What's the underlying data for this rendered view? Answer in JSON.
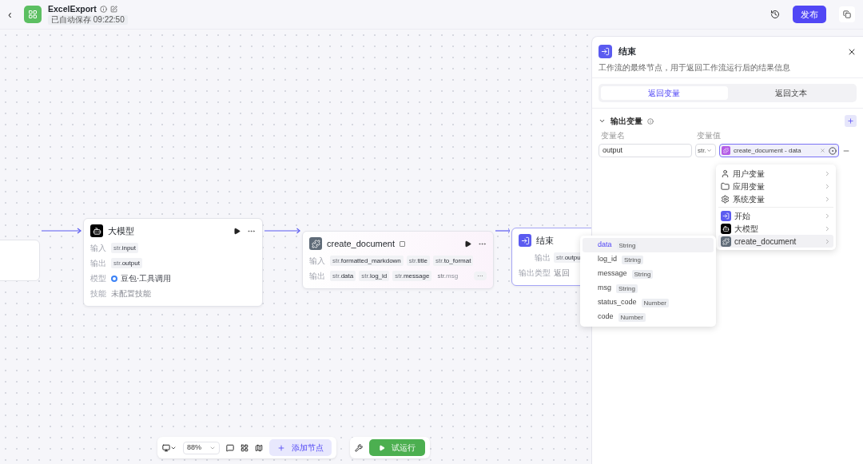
{
  "header": {
    "back": "‹",
    "title": "ExcelExport",
    "autosave": "已自动保存 09:22:50",
    "publish": "发布"
  },
  "nodes": [
    {
      "kind": "partial"
    },
    {
      "kind": "llm",
      "title": "大模型",
      "rows": [
        {
          "kind": "chips",
          "label": "输入",
          "chips": [
            {
              "prefix": "str.",
              "text": "input",
              "faded": false
            }
          ]
        },
        {
          "kind": "chips",
          "label": "输出",
          "chips": [
            {
              "prefix": "str.",
              "text": "output",
              "faded": false
            }
          ]
        },
        {
          "kind": "model",
          "label": "模型",
          "text": "豆包·工具调用"
        },
        {
          "kind": "empty",
          "label": "技能",
          "text": "未配置技能"
        }
      ]
    },
    {
      "kind": "plugin",
      "title": "create_document",
      "rows": [
        {
          "kind": "chips",
          "label": "输入",
          "chips": [
            {
              "prefix": "str.",
              "text": "formatted_markdown",
              "faded": false
            },
            {
              "prefix": "str.",
              "text": "title",
              "faded": false
            },
            {
              "prefix": "str.",
              "text": "to_format",
              "faded": false
            }
          ]
        },
        {
          "kind": "chips",
          "label": "输出",
          "more": "···",
          "chips": [
            {
              "prefix": "str.",
              "text": "data",
              "faded": false
            },
            {
              "prefix": "str.",
              "text": "log_id",
              "faded": false
            },
            {
              "prefix": "str.",
              "text": "message",
              "faded": false
            },
            {
              "prefix": "str.",
              "text": "msg",
              "faded": true
            }
          ]
        }
      ]
    },
    {
      "kind": "end",
      "title": "结束",
      "rows": [
        {
          "kind": "chips",
          "label": "输出",
          "chips": [
            {
              "prefix": "str.",
              "text": "outpu",
              "faded": false
            }
          ]
        },
        {
          "kind": "empty",
          "label": "输出类型",
          "text": "返回"
        }
      ]
    }
  ],
  "panel": {
    "title": "结束",
    "description": "工作流的最终节点，用于返回工作流运行后的结果信息",
    "tabs": [
      {
        "label": "返回变量",
        "selected": true
      },
      {
        "label": "返回文本",
        "selected": false
      }
    ],
    "section": {
      "title": "输出变量",
      "expanded": true,
      "col_name": "变量名",
      "col_value": "变量值",
      "row": {
        "name": "output",
        "type": "str.",
        "ref": "create_document - data"
      }
    }
  },
  "menu": [
    {
      "kind": "user",
      "label": "用户变量",
      "selected": false
    },
    {
      "kind": "app",
      "label": "应用变量",
      "selected": false
    },
    {
      "kind": "system",
      "label": "系统变量",
      "selected": false
    },
    {
      "kind": "start",
      "label": "开始",
      "selected": false
    },
    {
      "kind": "llm",
      "label": "大模型",
      "selected": false
    },
    {
      "kind": "plugin",
      "label": "create_document",
      "selected": true
    }
  ],
  "submenu": [
    {
      "name": "data",
      "type": "String",
      "selected": true
    },
    {
      "name": "log_id",
      "type": "String",
      "selected": false
    },
    {
      "name": "message",
      "type": "String",
      "selected": false
    },
    {
      "name": "msg",
      "type": "String",
      "selected": false
    },
    {
      "name": "status_code",
      "type": "Number",
      "selected": false
    },
    {
      "name": "code",
      "type": "Number",
      "selected": false
    }
  ],
  "toolbar": {
    "zoom": "88%",
    "add_node": "添加节点",
    "run": "试运行"
  }
}
